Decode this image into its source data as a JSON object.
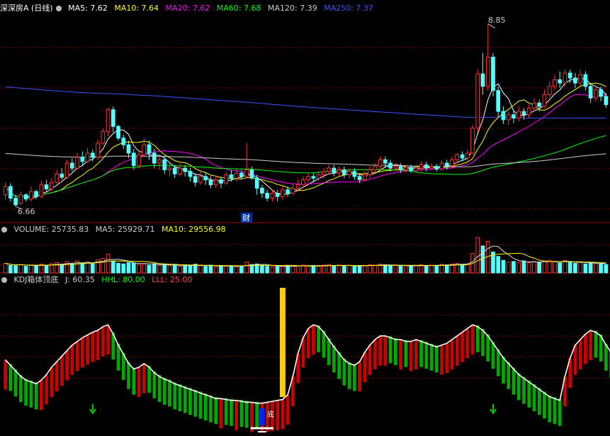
{
  "header1": {
    "title": "深深房A (日线)",
    "ma": [
      {
        "label": "MA5: 7.62",
        "color": "#ffffff"
      },
      {
        "label": "MA10: 7.64",
        "color": "#ffff00"
      },
      {
        "label": "MA20: 7.62",
        "color": "#ff00ff"
      },
      {
        "label": "MA60: 7.68",
        "color": "#00ff00"
      },
      {
        "label": "MA120: 7.39",
        "color": "#cccccc"
      },
      {
        "label": "MA250: 7.37",
        "color": "#3355ff"
      }
    ]
  },
  "header2": {
    "items": [
      {
        "label": "VOLUME: 25735.83",
        "color": "#cccccc"
      },
      {
        "label": "MA5: 25929.71",
        "color": "#cccccc"
      },
      {
        "label": "MA10: 29556.98",
        "color": "#ffff00"
      }
    ]
  },
  "header3": {
    "items": [
      {
        "label": "KDJ箱体顶底",
        "color": "#cccccc"
      },
      {
        "label": "J: 60.35",
        "color": "#cccccc"
      },
      {
        "label": "HHL: 80.00",
        "color": "#00ff00"
      },
      {
        "label": "LLL: 25.00",
        "color": "#ff4444"
      }
    ]
  },
  "annotations": {
    "high": "8.85",
    "low": "6.66",
    "cai": "财",
    "di": "底"
  },
  "colors": {
    "up": "#ff3232",
    "down": "#54ffff",
    "grid": "#8b0000",
    "kdj_up": "#cc0000",
    "kdj_down": "#00aa00",
    "signal": "#ffcc00",
    "bottom": "#0022ff",
    "arrow": "#00cc00"
  },
  "chart_data": {
    "type": "candlestick",
    "price_range": [
      6.66,
      8.85
    ],
    "candles": [
      [
        6.8,
        6.9,
        6.74,
        6.95
      ],
      [
        6.9,
        6.76,
        6.72,
        6.94
      ],
      [
        6.76,
        6.68,
        6.66,
        6.8
      ],
      [
        6.7,
        6.8,
        6.68,
        6.84
      ],
      [
        6.8,
        6.75,
        6.72,
        6.82
      ],
      [
        6.75,
        6.84,
        6.72,
        6.9
      ],
      [
        6.84,
        6.78,
        6.75,
        6.86
      ],
      [
        6.78,
        6.92,
        6.76,
        6.97
      ],
      [
        6.92,
        6.87,
        6.84,
        6.98
      ],
      [
        6.87,
        6.95,
        6.85,
        7.0
      ],
      [
        6.95,
        7.05,
        6.93,
        7.1
      ],
      [
        7.05,
        7.01,
        6.98,
        7.12
      ],
      [
        7.01,
        7.18,
        6.99,
        7.22
      ],
      [
        7.18,
        7.12,
        7.08,
        7.24
      ],
      [
        7.12,
        7.25,
        7.1,
        7.3
      ],
      [
        7.25,
        7.2,
        7.15,
        7.32
      ],
      [
        7.2,
        7.3,
        7.18,
        7.36
      ],
      [
        7.3,
        7.25,
        7.2,
        7.34
      ],
      [
        7.25,
        7.42,
        7.22,
        7.46
      ],
      [
        7.42,
        7.56,
        7.4,
        7.6
      ],
      [
        7.56,
        7.82,
        7.5,
        7.84
      ],
      [
        7.82,
        7.62,
        7.55,
        7.86
      ],
      [
        7.62,
        7.48,
        7.45,
        7.64
      ],
      [
        7.48,
        7.4,
        7.35,
        7.52
      ],
      [
        7.4,
        7.3,
        7.24,
        7.45
      ],
      [
        7.3,
        7.15,
        7.1,
        7.35
      ],
      [
        7.15,
        7.28,
        7.12,
        7.34
      ],
      [
        7.28,
        7.4,
        7.25,
        7.48
      ],
      [
        7.4,
        7.3,
        7.22,
        7.45
      ],
      [
        7.3,
        7.18,
        7.12,
        7.35
      ],
      [
        7.18,
        7.22,
        7.1,
        7.28
      ],
      [
        7.22,
        7.1,
        7.05,
        7.26
      ],
      [
        7.1,
        7.12,
        7.02,
        7.18
      ],
      [
        7.12,
        7.05,
        7.0,
        7.16
      ],
      [
        7.05,
        7.12,
        7.02,
        7.18
      ],
      [
        7.12,
        7.08,
        7.02,
        7.16
      ],
      [
        7.08,
        7.02,
        6.96,
        7.12
      ],
      [
        7.02,
        6.95,
        6.9,
        7.06
      ],
      [
        6.95,
        7.02,
        6.92,
        7.08
      ],
      [
        7.02,
        6.98,
        6.92,
        7.06
      ],
      [
        6.98,
        6.92,
        6.88,
        7.02
      ],
      [
        6.92,
        6.98,
        6.88,
        7.03
      ],
      [
        6.98,
        6.94,
        6.88,
        7.02
      ],
      [
        6.94,
        7.04,
        6.92,
        7.08
      ],
      [
        7.04,
        7.0,
        6.96,
        7.1
      ],
      [
        7.0,
        7.06,
        6.96,
        7.12
      ],
      [
        7.06,
        7.02,
        6.98,
        7.1
      ],
      [
        7.02,
        7.1,
        7.0,
        7.42
      ],
      [
        7.1,
        7.0,
        6.98,
        7.14
      ],
      [
        7.0,
        6.88,
        6.8,
        7.04
      ],
      [
        6.88,
        6.82,
        6.76,
        6.92
      ],
      [
        6.82,
        6.76,
        6.72,
        6.86
      ],
      [
        6.76,
        6.82,
        6.72,
        6.86
      ],
      [
        6.82,
        6.78,
        6.72,
        6.86
      ],
      [
        6.78,
        6.86,
        6.74,
        6.9
      ],
      [
        6.86,
        6.82,
        6.78,
        6.9
      ],
      [
        6.82,
        6.88,
        6.8,
        6.94
      ],
      [
        6.88,
        6.92,
        6.84,
        6.98
      ],
      [
        6.92,
        6.98,
        6.88,
        7.02
      ],
      [
        6.98,
        7.02,
        6.94,
        7.06
      ],
      [
        7.02,
        7.0,
        6.95,
        7.06
      ],
      [
        7.0,
        7.04,
        6.96,
        7.08
      ],
      [
        7.04,
        7.08,
        7.0,
        7.12
      ],
      [
        7.08,
        7.12,
        7.04,
        7.16
      ],
      [
        7.12,
        7.06,
        7.02,
        7.16
      ],
      [
        7.06,
        7.1,
        7.02,
        7.14
      ],
      [
        7.1,
        7.04,
        7.0,
        7.14
      ],
      [
        7.04,
        7.08,
        7.0,
        7.12
      ],
      [
        7.08,
        7.02,
        6.98,
        7.12
      ],
      [
        7.02,
        6.98,
        6.94,
        7.06
      ],
      [
        6.98,
        7.04,
        6.96,
        7.08
      ],
      [
        7.04,
        7.1,
        7.0,
        7.14
      ],
      [
        7.1,
        7.14,
        7.06,
        7.18
      ],
      [
        7.14,
        7.22,
        7.1,
        7.26
      ],
      [
        7.22,
        7.18,
        7.12,
        7.26
      ],
      [
        7.18,
        7.12,
        7.08,
        7.22
      ],
      [
        7.12,
        7.14,
        7.08,
        7.18
      ],
      [
        7.14,
        7.1,
        7.06,
        7.18
      ],
      [
        7.1,
        7.13,
        7.07,
        7.16
      ],
      [
        7.13,
        7.09,
        7.06,
        7.16
      ],
      [
        7.09,
        7.12,
        7.06,
        7.16
      ],
      [
        7.12,
        7.16,
        7.08,
        7.2
      ],
      [
        7.16,
        7.12,
        7.08,
        7.2
      ],
      [
        7.12,
        7.14,
        7.1,
        7.18
      ],
      [
        7.14,
        7.11,
        7.08,
        7.17
      ],
      [
        7.11,
        7.18,
        7.09,
        7.22
      ],
      [
        7.18,
        7.15,
        7.1,
        7.22
      ],
      [
        7.15,
        7.22,
        7.12,
        7.26
      ],
      [
        7.22,
        7.28,
        7.18,
        7.3
      ],
      [
        7.28,
        7.24,
        7.2,
        7.32
      ],
      [
        7.24,
        7.3,
        7.2,
        7.34
      ],
      [
        7.3,
        7.6,
        7.28,
        7.64
      ],
      [
        7.6,
        8.25,
        7.55,
        8.3
      ],
      [
        8.25,
        8.1,
        8.0,
        8.5
      ],
      [
        8.1,
        8.45,
        8.05,
        8.85
      ],
      [
        8.45,
        8.05,
        7.98,
        8.5
      ],
      [
        8.05,
        7.8,
        7.72,
        8.1
      ],
      [
        7.8,
        7.7,
        7.65,
        7.86
      ],
      [
        7.7,
        7.76,
        7.64,
        7.8
      ],
      [
        7.76,
        7.72,
        7.66,
        7.82
      ],
      [
        7.72,
        7.8,
        7.68,
        7.86
      ],
      [
        7.8,
        7.76,
        7.7,
        7.84
      ],
      [
        7.76,
        7.84,
        7.72,
        7.88
      ],
      [
        7.84,
        7.9,
        7.8,
        7.96
      ],
      [
        7.9,
        7.86,
        7.8,
        7.94
      ],
      [
        7.86,
        8.0,
        7.84,
        8.06
      ],
      [
        8.0,
        8.1,
        7.96,
        8.16
      ],
      [
        8.1,
        8.18,
        8.06,
        8.24
      ],
      [
        8.18,
        8.14,
        8.08,
        8.28
      ],
      [
        8.14,
        8.26,
        8.1,
        8.3
      ],
      [
        8.26,
        8.2,
        8.14,
        8.3
      ],
      [
        8.2,
        8.14,
        8.08,
        8.26
      ],
      [
        8.14,
        8.24,
        8.1,
        8.3
      ],
      [
        8.24,
        8.1,
        8.05,
        8.28
      ],
      [
        8.1,
        7.96,
        7.9,
        8.14
      ],
      [
        7.96,
        8.06,
        7.92,
        8.1
      ],
      [
        8.06,
        7.98,
        7.92,
        8.1
      ],
      [
        7.98,
        7.88,
        7.84,
        8.02
      ]
    ],
    "volume": [
      3.2,
      2.5,
      2.4,
      2.8,
      2.2,
      2.6,
      2.3,
      2.9,
      2.4,
      3.1,
      3.4,
      2.8,
      3.8,
      3.0,
      4.0,
      3.3,
      3.6,
      3.0,
      4.4,
      4.8,
      6.2,
      4.0,
      3.2,
      3.0,
      3.5,
      3.3,
      2.8,
      3.0,
      2.6,
      3.1,
      2.5,
      2.9,
      2.4,
      2.6,
      2.2,
      2.7,
      2.3,
      2.9,
      2.4,
      2.2,
      2.6,
      2.1,
      2.5,
      2.2,
      2.4,
      2.0,
      2.3,
      3.6,
      2.8,
      3.0,
      2.4,
      2.2,
      2.0,
      2.3,
      2.1,
      2.5,
      2.2,
      2.4,
      2.6,
      2.3,
      2.5,
      2.2,
      2.6,
      2.8,
      2.4,
      2.6,
      2.3,
      2.5,
      2.2,
      2.4,
      2.5,
      2.7,
      2.6,
      2.9,
      2.7,
      2.4,
      2.5,
      2.3,
      2.4,
      2.2,
      2.5,
      2.7,
      2.4,
      2.6,
      2.5,
      2.8,
      2.7,
      3.0,
      3.2,
      2.8,
      3.0,
      6.5,
      11.8,
      9.0,
      10.5,
      7.0,
      5.5,
      4.2,
      3.6,
      3.8,
      3.5,
      4.0,
      3.4,
      3.8,
      3.5,
      4.0,
      4.2,
      3.8,
      3.4,
      4.1,
      3.6,
      3.2,
      3.5,
      3.0,
      3.4,
      3.2,
      3.0,
      2.8
    ],
    "kdj_j": [
      48,
      42,
      36,
      30,
      26,
      24,
      22,
      26,
      32,
      40,
      46,
      52,
      58,
      64,
      68,
      72,
      75,
      78,
      80,
      84,
      86,
      76,
      64,
      54,
      44,
      38,
      40,
      44,
      40,
      34,
      30,
      27,
      25,
      22,
      20,
      18,
      16,
      14,
      12,
      10,
      8,
      6,
      6,
      5,
      4,
      4,
      3,
      2,
      2,
      1,
      1,
      2,
      3,
      4,
      5,
      10,
      30,
      55,
      72,
      82,
      86,
      84,
      78,
      70,
      62,
      55,
      48,
      44,
      42,
      46,
      56,
      64,
      70,
      74,
      74,
      72,
      70,
      70,
      68,
      68,
      70,
      68,
      66,
      64,
      62,
      64,
      66,
      70,
      74,
      78,
      82,
      86,
      84,
      80,
      74,
      66,
      58,
      50,
      44,
      38,
      32,
      28,
      24,
      20,
      16,
      12,
      8,
      6,
      4,
      30,
      50,
      64,
      70,
      76,
      80,
      78,
      74,
      64,
      56,
      50,
      44,
      36,
      30
    ],
    "signals": [
      54,
      159
    ],
    "bottom_marker": 50,
    "arrows": [
      17,
      95
    ]
  }
}
